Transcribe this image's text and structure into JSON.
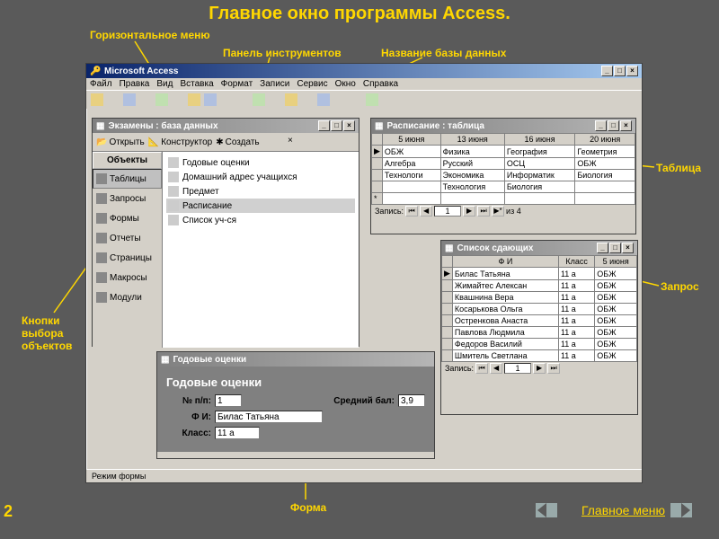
{
  "slide": {
    "title": "Главное окно программы Access.",
    "number": "2",
    "main_menu_link": "Главное меню"
  },
  "annotations": {
    "horiz_menu": "Горизонтальное меню",
    "toolbar": "Панель инструментов",
    "db_name": "Название базы данных",
    "table": "Таблица",
    "query": "Запрос",
    "form": "Форма",
    "obj_buttons": "Кнопки выбора объектов"
  },
  "app": {
    "title": "Microsoft Access",
    "menu": [
      "Файл",
      "Правка",
      "Вид",
      "Вставка",
      "Формат",
      "Записи",
      "Сервис",
      "Окно",
      "Справка"
    ],
    "status": "Режим формы"
  },
  "dbwin": {
    "title": "Экзамены : база данных",
    "toolbar": {
      "open": "Открыть",
      "design": "Конструктор",
      "create": "Создать"
    },
    "objects_header": "Объекты",
    "objects": [
      "Таблицы",
      "Запросы",
      "Формы",
      "Отчеты",
      "Страницы",
      "Макросы",
      "Модули"
    ],
    "list": [
      "Годовые оценки",
      "Домашний адрес учащихся",
      "Предмет",
      "Расписание",
      "Список уч-ся"
    ]
  },
  "table1": {
    "title": "Расписание : таблица",
    "headers": [
      "5 июня",
      "13 июня",
      "16 июня",
      "20 июня"
    ],
    "rows": [
      [
        "ОБЖ",
        "Физика",
        "География",
        "Геометрия"
      ],
      [
        "Алгебра",
        "Русский",
        "ОСЦ",
        "ОБЖ"
      ],
      [
        "Технологи",
        "Экономика",
        "Информатик",
        "Биология"
      ],
      [
        "",
        "Технология",
        "Биология",
        ""
      ]
    ],
    "nav": {
      "label": "Запись:",
      "pos": "1",
      "of": "из 4"
    }
  },
  "query": {
    "title": "Список сдающих",
    "headers": [
      "Ф И",
      "Класс",
      "5 июня"
    ],
    "rows": [
      [
        "Билас Татьяна",
        "11 а",
        "ОБЖ"
      ],
      [
        "Жимайтес Алексан",
        "11 а",
        "ОБЖ"
      ],
      [
        "Квашнина Вера",
        "11 а",
        "ОБЖ"
      ],
      [
        "Косарькова Ольга",
        "11 а",
        "ОБЖ"
      ],
      [
        "Остренкова Анаста",
        "11 а",
        "ОБЖ"
      ],
      [
        "Павлова Людмила",
        "11 а",
        "ОБЖ"
      ],
      [
        "Федоров Василий",
        "11 а",
        "ОБЖ"
      ],
      [
        "Шмитель Светлана",
        "11 а",
        "ОБЖ"
      ]
    ],
    "nav": {
      "label": "Запись:",
      "pos": "1"
    }
  },
  "form": {
    "title": "Годовые оценки",
    "heading": "Годовые оценки",
    "fields": {
      "num_label": "№ п/п:",
      "num": "1",
      "avg_label": "Средний бал:",
      "avg": "3,9",
      "fio_label": "Ф И:",
      "fio": "Билас Татьяна",
      "class_label": "Класс:",
      "class": "11 а"
    }
  }
}
